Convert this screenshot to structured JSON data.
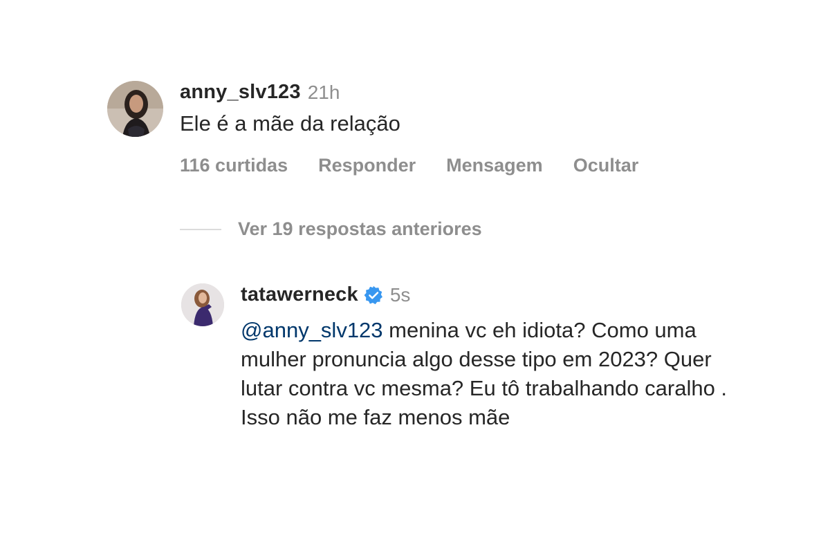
{
  "comment": {
    "username": "anny_slv123",
    "time": "21h",
    "text": "Ele é a mãe da relação",
    "avatar_icon": "user-avatar-photo",
    "actions": {
      "likes": "116 curtidas",
      "reply": "Responder",
      "message": "Mensagem",
      "hide": "Ocultar"
    }
  },
  "replies_toggle": {
    "label": "Ver 19 respostas anteriores"
  },
  "reply": {
    "username": "tatawerneck",
    "verified": true,
    "verified_icon": "verified-badge-icon",
    "time": "5s",
    "mention": "@anny_slv123",
    "text": " menina vc eh idiota? Como uma mulher pronuncia algo desse tipo em 2023? Quer lutar contra vc mesma? Eu tô trabalhando caralho . Isso não me faz menos mãe",
    "avatar_icon": "user-avatar-photo"
  },
  "colors": {
    "primary_text": "#262626",
    "secondary_text": "#8e8e8e",
    "mention": "#00376b",
    "verified_blue": "#3897f0",
    "divider": "#dbdbdb"
  }
}
